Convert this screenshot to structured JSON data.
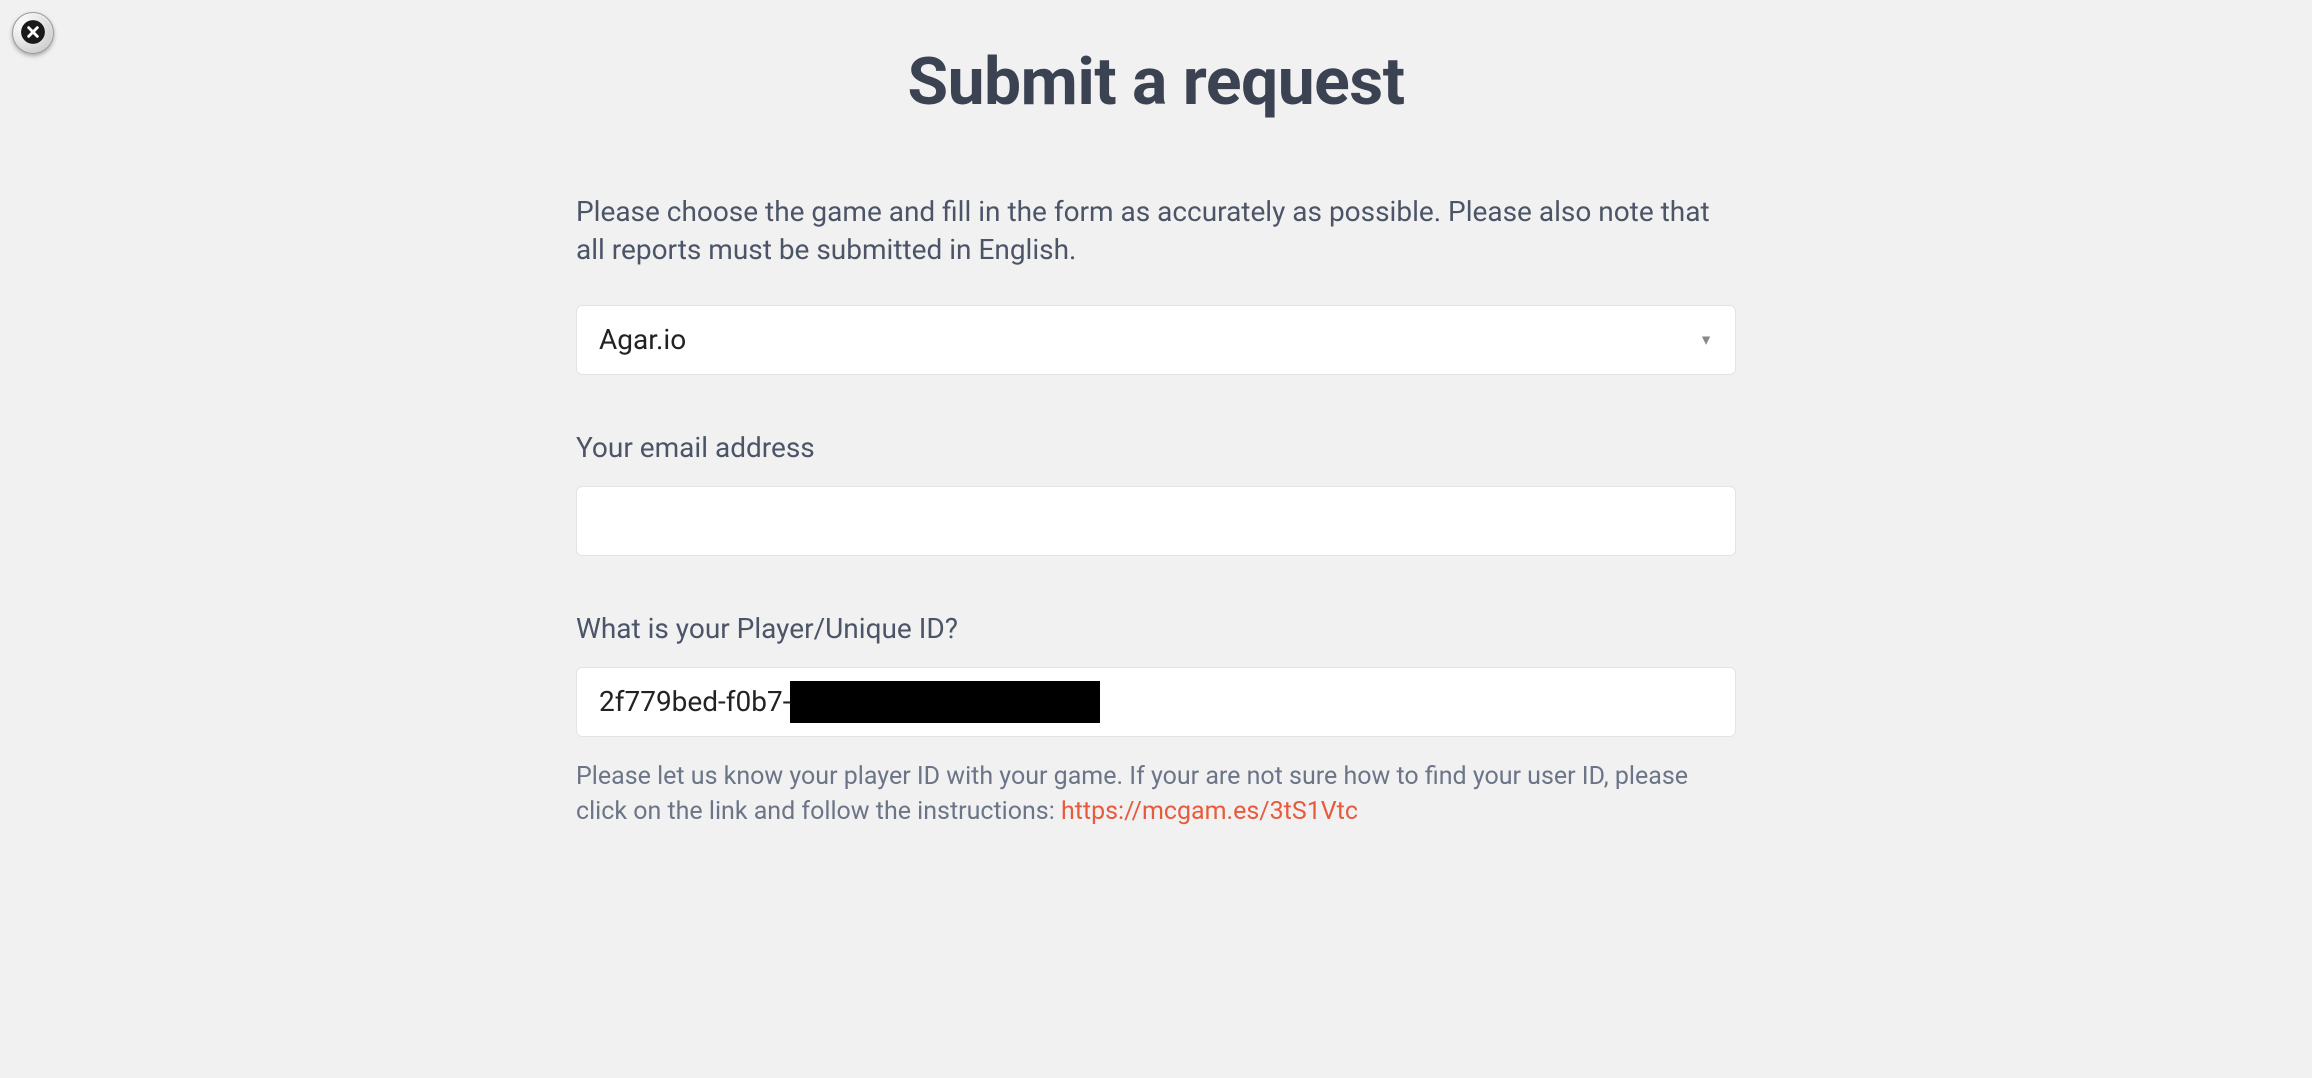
{
  "title": "Submit a request",
  "instructions": "Please choose the game and fill in the form as accurately as possible. Please also note that all reports must be submitted in English.",
  "game": {
    "selected": "Agar.io"
  },
  "email": {
    "label": "Your email address",
    "value": ""
  },
  "playerId": {
    "label": "What is your Player/Unique ID?",
    "valueVisible": "2f779bed-f0b7-",
    "helperPrefix": "Please let us know your player ID with your game. If your are not sure how to find your user ID, please click on the link and follow the instructions: ",
    "helperLink": "https://mcgam.es/3tS1Vtc"
  }
}
